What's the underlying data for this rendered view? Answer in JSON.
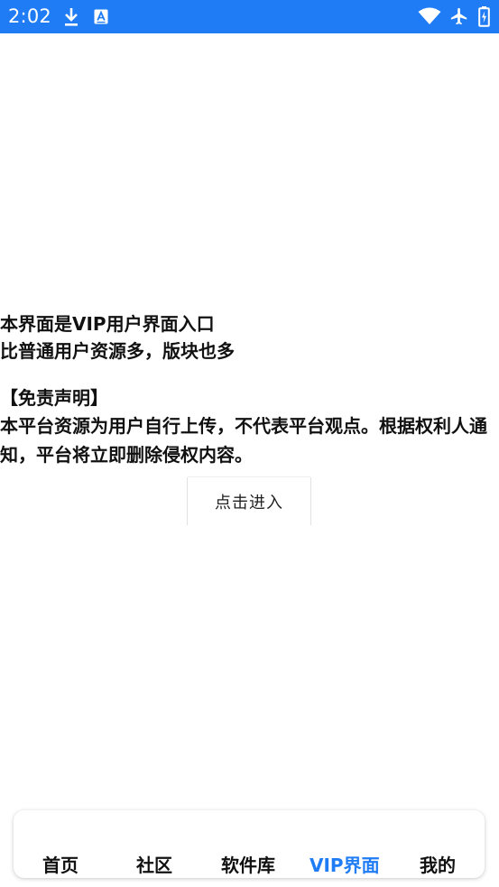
{
  "status_bar": {
    "time": "2:02",
    "icons": [
      "download-icon",
      "app-notification-icon",
      "wifi-icon",
      "airplane-mode-icon",
      "battery-icon"
    ],
    "background_color": "#1f7cf5"
  },
  "main": {
    "intro_line_1": "本界面是VIP用户界面入口",
    "intro_line_2": "比普通用户资源多，版块也多",
    "disclaimer_title": "【免责声明】",
    "disclaimer_text": "本平台资源为用户自行上传，不代表平台观点。根据权利人通知，平台将立即删除侵权内容。",
    "enter_button_label": "点击进入"
  },
  "bottom_nav": {
    "items": [
      {
        "label": "首页",
        "active": false
      },
      {
        "label": "社区",
        "active": false
      },
      {
        "label": "软件库",
        "active": false
      },
      {
        "label": "VIP界面",
        "active": true
      },
      {
        "label": "我的",
        "active": false
      }
    ],
    "active_color": "#1f7cf5"
  }
}
